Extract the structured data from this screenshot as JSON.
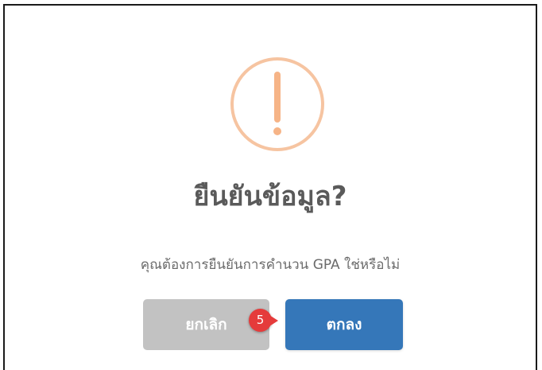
{
  "dialog": {
    "icon": "exclamation-circle-icon",
    "icon_color": "#f6b487",
    "title": "ยืนยันข้อมูล?",
    "message": "คุณต้องการยืนยันการคำนวน GPA ใช่หรือไม่",
    "buttons": {
      "cancel_label": "ยกเลิก",
      "ok_label": "ตกลง"
    },
    "colors": {
      "cancel": "#c2c2c2",
      "ok": "#3577b9"
    }
  },
  "annotation": {
    "step_number": "5",
    "color": "#e53b3b"
  }
}
